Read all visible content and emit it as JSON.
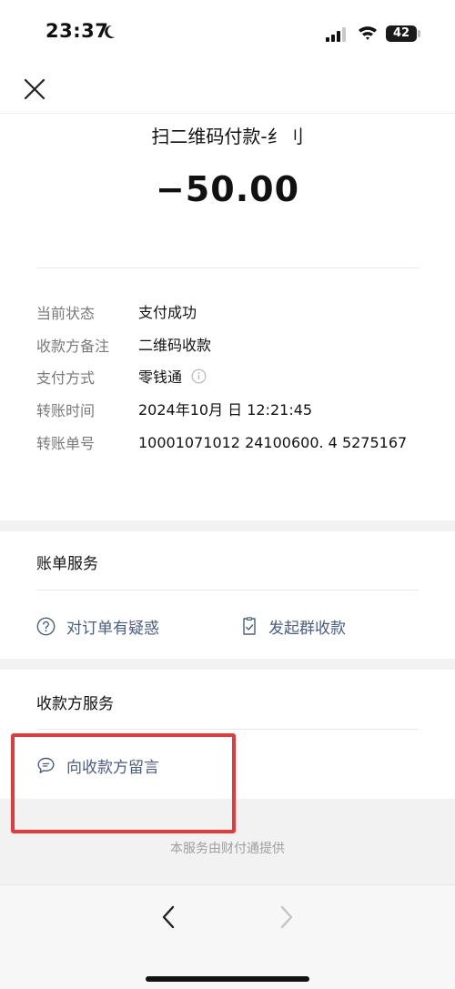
{
  "status_bar": {
    "time": "23:37",
    "battery": "42"
  },
  "header": {
    "title": "扫二维码付款-纟刂",
    "amount": "−50.00"
  },
  "details": [
    {
      "label": "当前状态",
      "value": "支付成功"
    },
    {
      "label": "收款方备注",
      "value": "二维码收款"
    },
    {
      "label": "支付方式",
      "value": "零钱通"
    },
    {
      "label": "转账时间",
      "value": "2024年10月 日 12:21:45"
    },
    {
      "label": "转账单号",
      "value": "10001071012 24100600. 4 5275167"
    }
  ],
  "bill_service": {
    "title": "账单服务",
    "actions": [
      {
        "label": "对订单有疑惑",
        "icon": "question-circle-icon"
      },
      {
        "label": "发起群收款",
        "icon": "document-check-icon"
      }
    ]
  },
  "payee_service": {
    "title": "收款方服务",
    "actions": [
      {
        "label": "向收款方留言",
        "icon": "chat-bubble-icon"
      }
    ]
  },
  "footer": {
    "text": "本服务由财付通提供"
  },
  "colors": {
    "link": "#4a5d87",
    "highlight": "#e33b3b",
    "band": "#f2f2f2"
  }
}
